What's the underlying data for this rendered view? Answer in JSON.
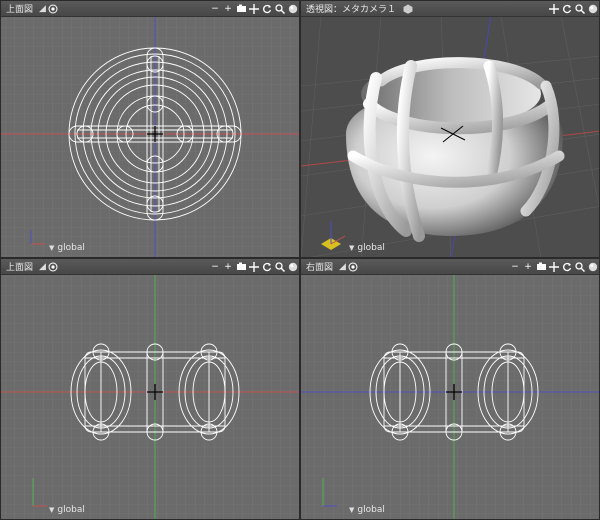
{
  "viewports": {
    "top": {
      "title": "上面図",
      "corner": "◢",
      "coord_system": "global"
    },
    "persp": {
      "title": "透視図：メタカメラ１",
      "coord_system": "global"
    },
    "front": {
      "title": "上面図",
      "corner": "◢",
      "coord_system": "global"
    },
    "right": {
      "title": "右面図",
      "corner": "◢",
      "coord_system": "global"
    }
  },
  "toolbar": {
    "minus": "−",
    "plus": "+"
  },
  "colors": {
    "viewport_bg": "#6b6b6b",
    "grid_line": "#7a7a7a",
    "x_axis": "#c05050",
    "y_axis": "#50b050",
    "z_axis": "#5050c0",
    "wire": "#ffffff"
  },
  "icons": [
    "eye-icon",
    "minus-icon",
    "camera-icon",
    "move-icon",
    "rotate-icon",
    "zoom-icon",
    "sphere-icon",
    "cube-icon"
  ]
}
